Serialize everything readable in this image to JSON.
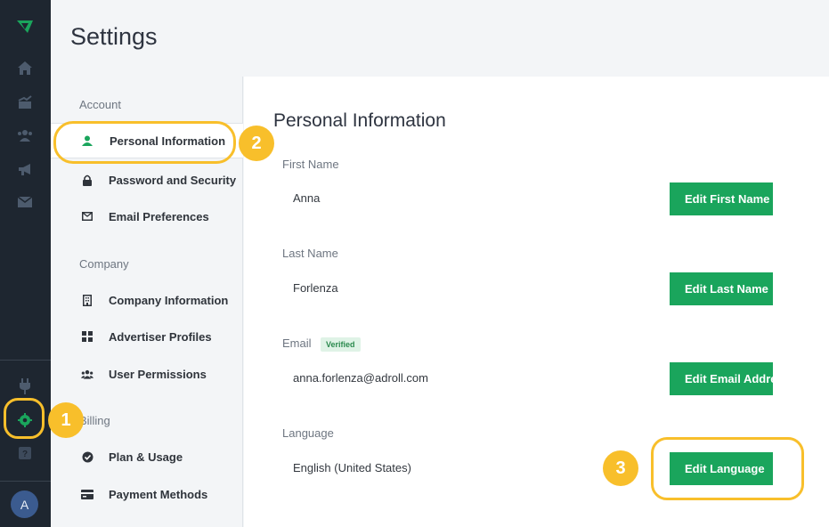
{
  "header": {
    "title": "Settings"
  },
  "rail": {
    "icons": [
      "logo-icon",
      "home-icon",
      "chart-icon",
      "users-icon",
      "megaphone-icon",
      "mail-icon",
      "plug-icon",
      "gear-icon",
      "help-icon"
    ],
    "avatar_initial": "A",
    "accent": "#1aa55c"
  },
  "subnav": {
    "sections": [
      {
        "title": "Account",
        "items": [
          {
            "label": "Personal Information",
            "icon": "user-icon",
            "active": true
          },
          {
            "label": "Password and Security",
            "icon": "lock-icon"
          },
          {
            "label": "Email Preferences",
            "icon": "envelope-icon"
          }
        ]
      },
      {
        "title": "Company",
        "items": [
          {
            "label": "Company Information",
            "icon": "building-icon"
          },
          {
            "label": "Advertiser Profiles",
            "icon": "grid-icon"
          },
          {
            "label": "User Permissions",
            "icon": "users-icon"
          }
        ]
      },
      {
        "title": "Billing",
        "items": [
          {
            "label": "Plan & Usage",
            "icon": "check-badge-icon"
          },
          {
            "label": "Payment Methods",
            "icon": "credit-card-icon"
          }
        ]
      }
    ]
  },
  "main": {
    "title": "Personal Information",
    "fields": [
      {
        "label": "First Name",
        "value": "Anna",
        "button": "Edit First Name"
      },
      {
        "label": "Last Name",
        "value": "Forlenza",
        "button": "Edit Last Name"
      },
      {
        "label": "Email",
        "badge": "Verified",
        "value": "anna.forlenza@adroll.com",
        "button": "Edit Email Address"
      },
      {
        "label": "Language",
        "value": "English (United States)",
        "button": "Edit Language"
      }
    ]
  },
  "steps": [
    "1",
    "2",
    "3"
  ],
  "colors": {
    "button": "#1aa55c",
    "highlight": "#f8bf2b",
    "rail": "#1e2630"
  }
}
